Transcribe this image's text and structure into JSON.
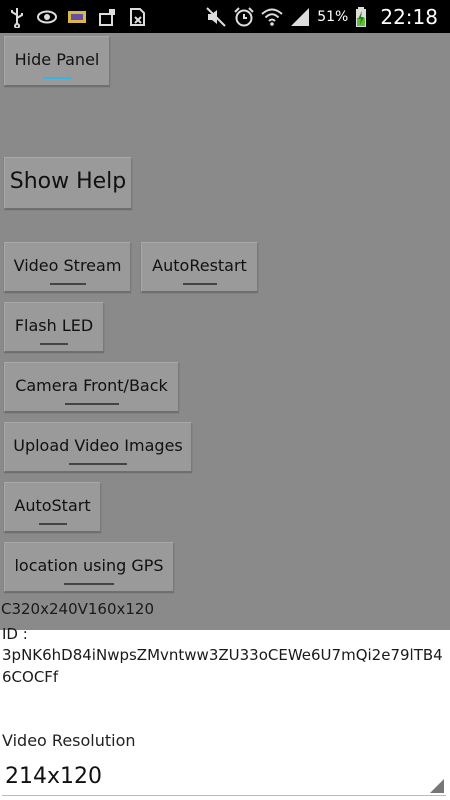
{
  "status_bar": {
    "icons_left": [
      "usb-icon",
      "eye-icon",
      "photo-icon",
      "sim-lock-icon",
      "no-sim-icon"
    ],
    "icons_right": [
      "mute-icon",
      "alarm-icon",
      "wifi-icon",
      "signal-icon",
      "battery-charging-icon"
    ],
    "battery": "51%",
    "time": "22:18"
  },
  "buttons": {
    "hide_panel": "Hide Panel",
    "show_help": "Show Help",
    "video_stream": "Video Stream",
    "auto_restart": "AutoRestart",
    "flash_led": "Flash LED",
    "camera_front_back": "Camera Front/Back",
    "upload_video_images": "Upload Video Images",
    "auto_start": "AutoStart",
    "location_gps": "location using GPS"
  },
  "info": {
    "resolution_code": "C320x240V160x120",
    "id_label": "ID :",
    "id_value": "3pNK6hD84iNwpsZMvntww3ZU33oCEWe6U7mQi2e79lTB46COCFf"
  },
  "video_resolution": {
    "label": "Video Resolution",
    "selected": "214x120"
  },
  "colors": {
    "accent": "#33b5e5",
    "panel_bg": "#8a8a8a",
    "statusbar_bg": "#000000"
  }
}
